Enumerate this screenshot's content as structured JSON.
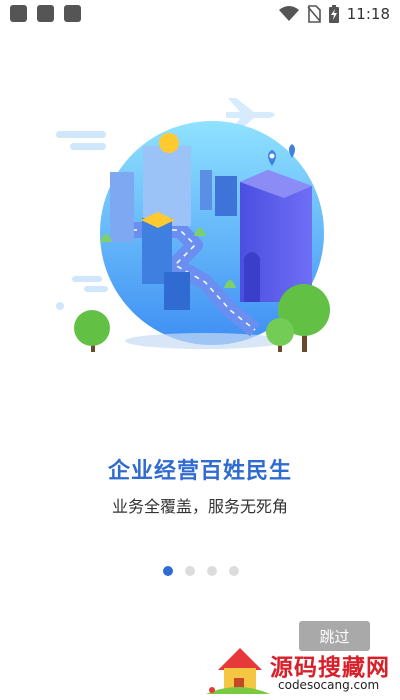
{
  "status_bar": {
    "time": "11:18",
    "icons": [
      "wifi-icon",
      "no-sim-icon",
      "battery-charging-icon"
    ]
  },
  "onboarding": {
    "headline": "企业经营百姓民生",
    "subtitle": "业务全覆盖，服务无死角",
    "page_count": 4,
    "active_page": 1
  },
  "skip_button": {
    "label": "跳过"
  },
  "watermark": {
    "title": "源码搜藏网",
    "url": "codesocang.com"
  },
  "colors": {
    "accent": "#2f6bd0",
    "skip_bg": "#a9a9a9",
    "watermark_red": "#d8202a"
  }
}
